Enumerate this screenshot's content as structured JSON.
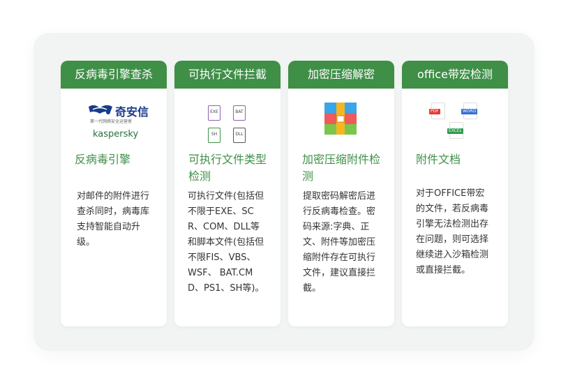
{
  "cards": [
    {
      "header": "反病毒引擎查杀",
      "title": "反病毒引擎",
      "desc": "对邮件的附件进行查杀同时，病毒库支持智能自动升级。",
      "logo": {
        "brand1": "奇安信",
        "brand1_sub": "第一代网络安全运营者",
        "brand2": "kaspersky",
        "icon": "qianxin-logo-icon"
      }
    },
    {
      "header": "可执行文件拦截",
      "title": "可执行文件类型检测",
      "desc": "可执行文件(包括但不限于EXE、SCR、COM、DLL等和脚本文件(包括但不限FIS、VBS、WSF、 BAT.CMD、PS1、SH等)。",
      "icons": [
        "EXE",
        "BAT",
        "SH",
        "DLL"
      ]
    },
    {
      "header": "加密压缩解密",
      "title": "加密压缩附件检测",
      "desc": "提取密码解密后进行反病毒检查。密码来源:字典、正文、附件等加密压缩附件存在可执行文件，建议直接拦截。",
      "icon": "archive-icon"
    },
    {
      "header": "office带宏检测",
      "title": "附件文档",
      "desc": "对于OFFICE带宏的文件，若反病毒引擎无法检测出存在问题，则可选择继续进入沙箱检测或直接拦截。",
      "icons": [
        "PDF",
        "WORD",
        "EXCEL"
      ]
    }
  ],
  "colors": {
    "accent": "#3f8f47",
    "panel_bg": "#f1f4f3",
    "card_bg": "#ffffff",
    "desc_text": "#333333"
  }
}
